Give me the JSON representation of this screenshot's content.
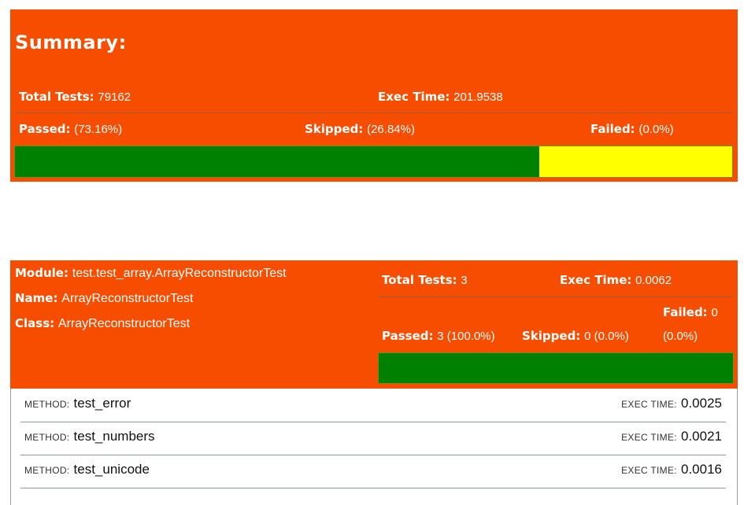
{
  "summary": {
    "title": "Summary:",
    "total_tests_label": "Total Tests:",
    "total_tests_value": "79162",
    "exec_time_label": "Exec Time:",
    "exec_time_value": "201.9538",
    "passed_label": "Passed:",
    "passed_value": "(73.16%)",
    "skipped_label": "Skipped:",
    "skipped_value": "(26.84%)",
    "failed_label": "Failed:",
    "failed_value": "(0.0%)",
    "progress": {
      "passed_fraction": 0.7316,
      "skipped_fraction": 0.2684,
      "failed_fraction": 0.0
    }
  },
  "module": {
    "module_label": "Module:",
    "module_value": "test.test_array.ArrayReconstructorTest",
    "name_label": "Name:",
    "name_value": "ArrayReconstructorTest",
    "class_label": "Class:",
    "class_value": "ArrayReconstructorTest",
    "total_tests_label": "Total Tests:",
    "total_tests_value": "3",
    "exec_time_label": "Exec Time:",
    "exec_time_value": "0.0062",
    "passed_label": "Passed:",
    "passed_value": "3 (100.0%)",
    "skipped_label": "Skipped:",
    "skipped_value": "0 (0.0%)",
    "failed_label": "Failed:",
    "failed_value": "0",
    "failed_pct": "(0.0%)",
    "progress": {
      "passed_fraction": 1.0
    }
  },
  "methods": [
    {
      "method_label": "METHOD:",
      "name": "test_error",
      "exec_label": "EXEC TIME:",
      "exec_value": "0.0025"
    },
    {
      "method_label": "METHOD:",
      "name": "test_numbers",
      "exec_label": "EXEC TIME:",
      "exec_value": "0.0021"
    },
    {
      "method_label": "METHOD:",
      "name": "test_unicode",
      "exec_label": "EXEC TIME:",
      "exec_value": "0.0016"
    }
  ],
  "colors": {
    "panel": "#f74d00",
    "passed": "#008000",
    "skipped": "#ffff00"
  }
}
